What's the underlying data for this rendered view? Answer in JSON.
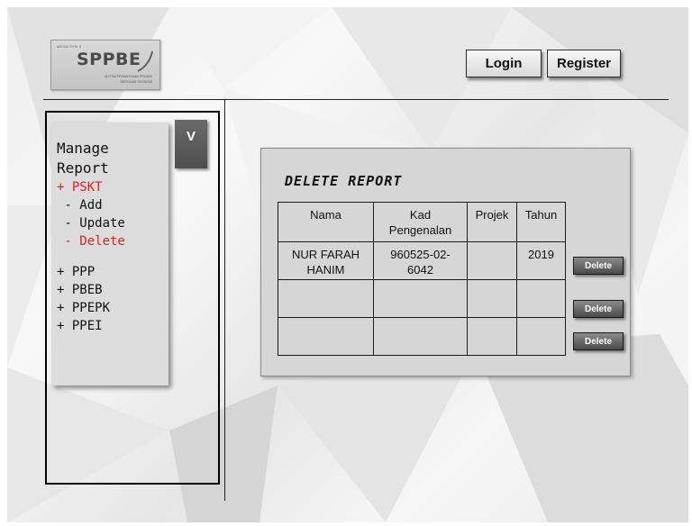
{
  "logo": {
    "small_top": "MEGA SYN 3",
    "brand": "SPPBE",
    "sub_line1": "SISTEM PEMANTAUAN PROJEK",
    "sub_line2": "BERTAJUK EKONOMI"
  },
  "header": {
    "login_label": "Login",
    "register_label": "Register"
  },
  "sidebar": {
    "title_line1": "Manage",
    "title_line2": "Report",
    "toggle_label": "V",
    "items": [
      {
        "label": "+ PSKT",
        "active": true
      },
      {
        "label": " - Add",
        "active": false
      },
      {
        "label": " - Update",
        "active": false
      },
      {
        "label": " - Delete",
        "active": true
      },
      {
        "label": "+ PPP",
        "active": false
      },
      {
        "label": "+ PBEB",
        "active": false
      },
      {
        "label": "+ PPEPK",
        "active": false
      },
      {
        "label": "+ PPEI",
        "active": false
      }
    ]
  },
  "main": {
    "title": "DELETE REPORT",
    "columns": [
      "Nama",
      "Kad Pengenalan",
      "Projek",
      "Tahun"
    ],
    "rows": [
      {
        "nama": "NUR FARAH HANIM",
        "kad": "960525-02-6042",
        "projek": "",
        "tahun": "2019"
      },
      {
        "nama": "",
        "kad": "",
        "projek": "",
        "tahun": ""
      },
      {
        "nama": "",
        "kad": "",
        "projek": "",
        "tahun": ""
      }
    ],
    "delete_label": "Delete"
  },
  "colors": {
    "active_menu": "#e02020",
    "toggle_bg": "#5a5a5a",
    "panel_bg": "#d6d6d6"
  }
}
